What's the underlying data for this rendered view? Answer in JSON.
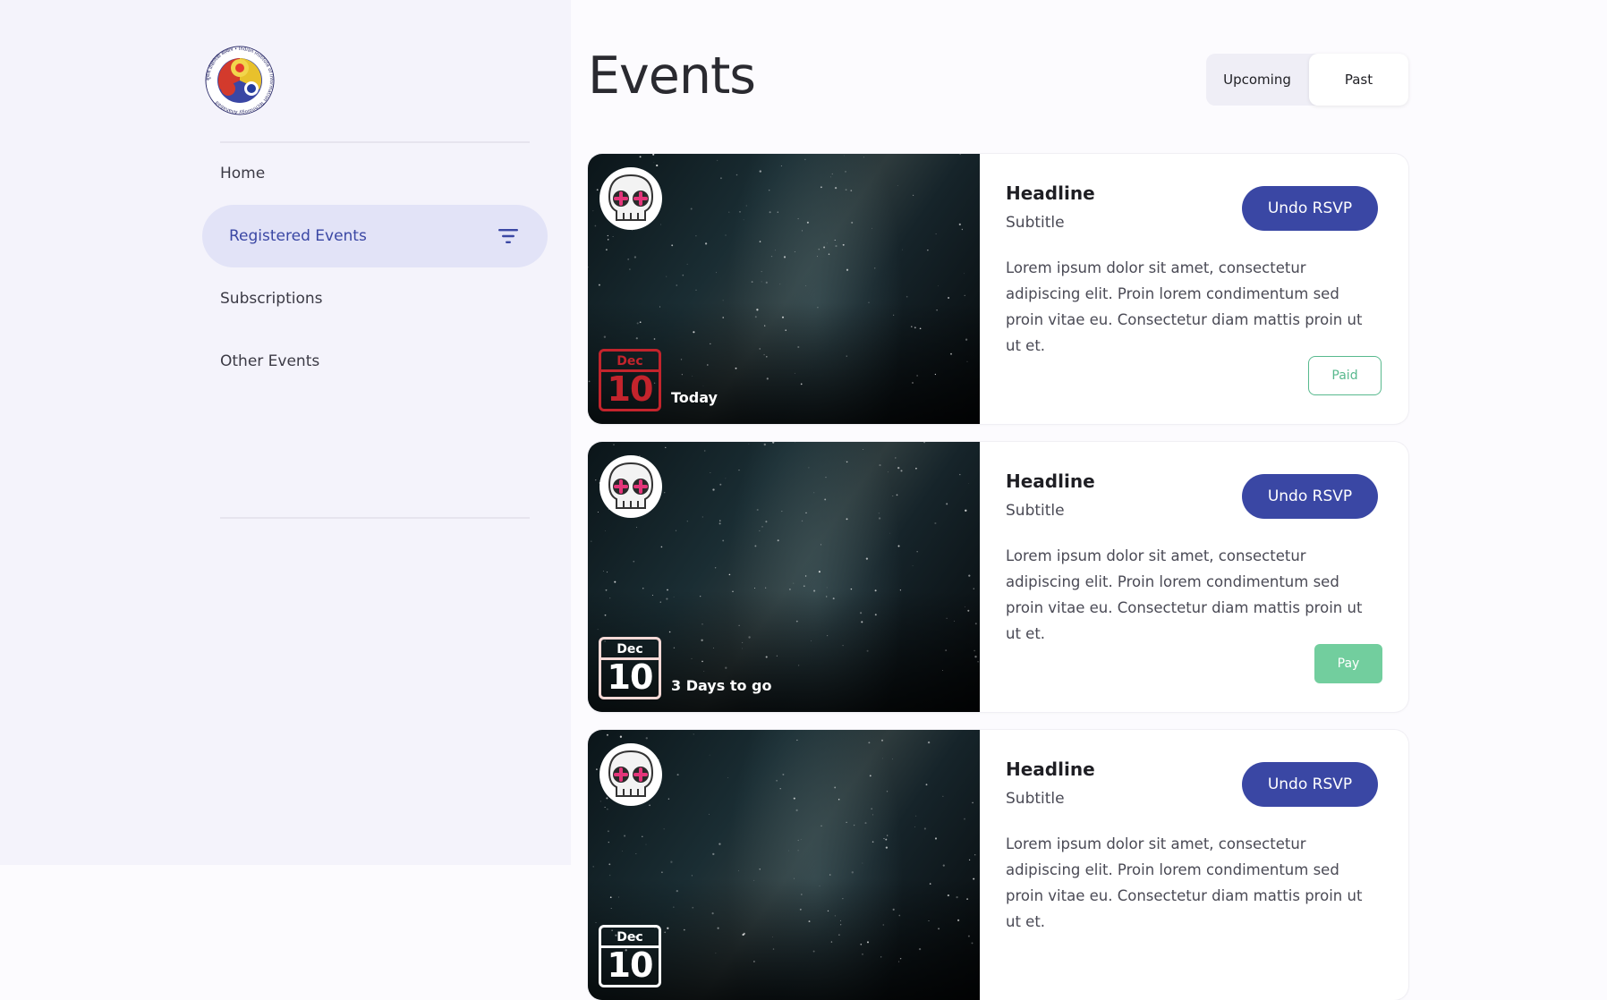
{
  "logo": {
    "text": "सूचना प्रौद्योगिकी संस्थान • Indian Institute of Information Technology Allahabad"
  },
  "sidebar": {
    "items": [
      {
        "label": "Home"
      },
      {
        "label": "Registered Events",
        "icon": "filter-icon"
      },
      {
        "label": "Subscriptions"
      },
      {
        "label": "Other Events"
      }
    ]
  },
  "header": {
    "title": "Events",
    "tabs": [
      {
        "label": "Upcoming",
        "selected": false
      },
      {
        "label": "Past",
        "selected": true
      }
    ]
  },
  "events": [
    {
      "headline": "Headline",
      "subtitle": "Subtitle",
      "body": "Lorem ipsum dolor sit amet, consectetur adipiscing elit. Proin lorem condimentum sed proin vitae eu. Consectetur diam mattis proin ut ut et.",
      "action_label": "Undo RSVP",
      "date_month": "Dec",
      "date_day": "10",
      "countdown": "Today",
      "payment_label": "Paid"
    },
    {
      "headline": "Headline",
      "subtitle": "Subtitle",
      "body": "Lorem ipsum dolor sit amet, consectetur adipiscing elit. Proin lorem condimentum sed proin vitae eu. Consectetur diam mattis proin ut ut et.",
      "action_label": "Undo RSVP",
      "date_month": "Dec",
      "date_day": "10",
      "countdown": "3 Days to go",
      "payment_label": "Pay"
    },
    {
      "headline": "Headline",
      "subtitle": "Subtitle",
      "body": "Lorem ipsum dolor sit amet, consectetur adipiscing elit. Proin lorem condimentum sed proin vitae eu. Consectetur diam mattis proin ut ut et.",
      "action_label": "Undo RSVP",
      "date_month": "Dec",
      "date_day": "10"
    }
  ],
  "colors": {
    "accent": "#3a47a4",
    "nav_active_bg": "#e2e3f7",
    "paid_green": "#58b98e",
    "pay_green": "#72ce9e",
    "today_red": "#c3242c"
  }
}
